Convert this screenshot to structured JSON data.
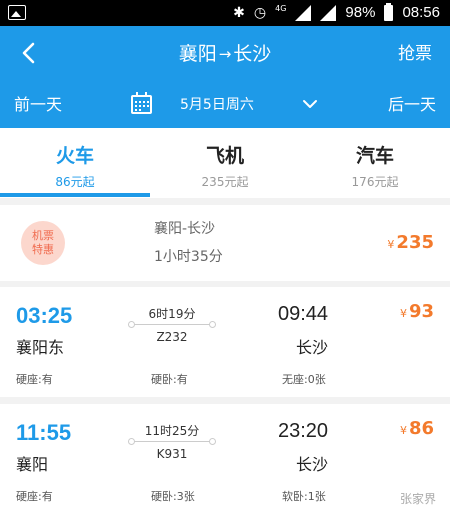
{
  "status_bar": {
    "network": "4G",
    "battery": "98%",
    "time": "08:56"
  },
  "header": {
    "title_from": "襄阳",
    "title_arrow": "→",
    "title_to": "长沙",
    "grab_label": "抢票"
  },
  "datebar": {
    "prev_label": "前一天",
    "date": "5月5日周六",
    "next_label": "后一天"
  },
  "tabs": [
    {
      "name": "火车",
      "price": "86元起"
    },
    {
      "name": "飞机",
      "price": "235元起"
    },
    {
      "name": "汽车",
      "price": "176元起"
    }
  ],
  "promo": {
    "badge_line1": "机票",
    "badge_line2": "特惠",
    "route": "襄阳-长沙",
    "duration": "1小时35分",
    "currency": "¥",
    "price": "235"
  },
  "trains": [
    {
      "dep_time": "03:25",
      "dep_station": "襄阳东",
      "duration": "6时19分",
      "train_no": "Z232",
      "arr_time": "09:44",
      "arr_station": "长沙",
      "currency": "¥",
      "price": "93",
      "seats": [
        "硬座:有",
        "硬卧:有",
        "无座:0张"
      ]
    },
    {
      "dep_time": "11:55",
      "dep_station": "襄阳",
      "duration": "11时25分",
      "train_no": "K931",
      "arr_time": "23:20",
      "arr_station": "长沙",
      "currency": "¥",
      "price": "86",
      "seats": [
        "硬座:有",
        "硬卧:3张",
        "软卧:1张"
      ]
    }
  ],
  "watermark": "张家界",
  "colors": {
    "accent": "#1e9ae8",
    "price": "#f37a2c",
    "badge_bg": "#fcd7cd",
    "badge_text": "#f06b4f"
  }
}
